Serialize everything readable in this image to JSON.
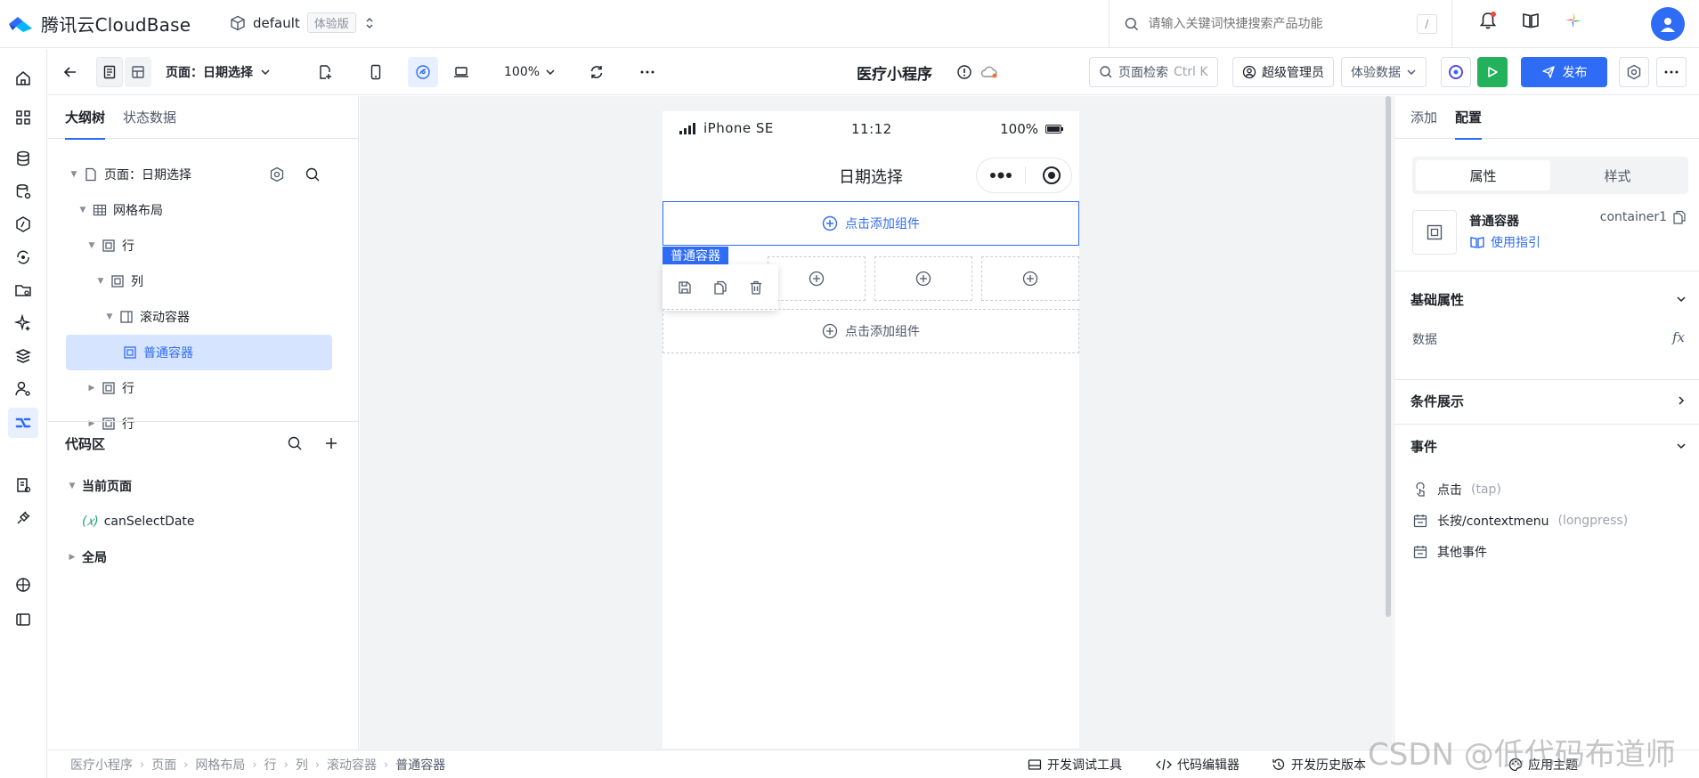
{
  "header": {
    "brand": "腾讯云CloudBase",
    "env_name": "default",
    "env_badge": "体验版",
    "search_placeholder": "请输入关键词快捷搜索产品功能",
    "search_shortcut": "/"
  },
  "toolbar": {
    "page_label": "页面：日期选择",
    "zoom": "100%",
    "app_title": "医疗小程序",
    "page_search_label": "页面检索",
    "page_search_shortcut": "Ctrl K",
    "role_label": "超级管理员",
    "data_mode": "体验数据",
    "publish_label": "发布"
  },
  "left_panel": {
    "tabs": [
      "大纲树",
      "状态数据"
    ],
    "tree": [
      {
        "label": "页面：日期选择",
        "level": 0
      },
      {
        "label": "网格布局",
        "level": 1
      },
      {
        "label": "行",
        "level": 2
      },
      {
        "label": "列",
        "level": 3
      },
      {
        "label": "滚动容器",
        "level": 4
      },
      {
        "label": "普通容器",
        "level": 5,
        "selected": true
      },
      {
        "label": "行",
        "level": 2
      },
      {
        "label": "行",
        "level": 2
      }
    ],
    "code_area_title": "代码区",
    "current_page_label": "当前页面",
    "variable_name": "canSelectDate",
    "variable_symbol": "(𝑥)",
    "global_label": "全局"
  },
  "phone": {
    "carrier": "iPhone SE",
    "time": "11:12",
    "battery": "100%",
    "page_title": "日期选择",
    "add_component_label": "点击添加组件",
    "selected_tag": "普通容器"
  },
  "right_panel": {
    "tabs": [
      "添加",
      "配置"
    ],
    "seg_tabs": [
      "属性",
      "样式"
    ],
    "component_name": "普通容器",
    "component_id": "container1",
    "guide_link": "使用指引",
    "basic_props_title": "基础属性",
    "data_label": "数据",
    "fx_label": "fx",
    "conditional_title": "条件展示",
    "events_title": "事件",
    "events": [
      {
        "name": "点击",
        "code": "(tap)"
      },
      {
        "name": "长按/contextmenu",
        "code": "(longpress)"
      },
      {
        "name": "其他事件",
        "code": ""
      }
    ]
  },
  "bottom_bar": {
    "breadcrumb": [
      "医疗小程序",
      "页面",
      "网格布局",
      "行",
      "列",
      "滚动容器",
      "普通容器"
    ],
    "tools": [
      "开发调试工具",
      "代码编辑器",
      "开发历史版本",
      "应用主题"
    ],
    "watermark": "CSDN @低代码布道师"
  },
  "colors": {
    "accent": "#2f6cf5",
    "run_green": "#23b15b",
    "selected_bg": "#d6e4ff"
  }
}
